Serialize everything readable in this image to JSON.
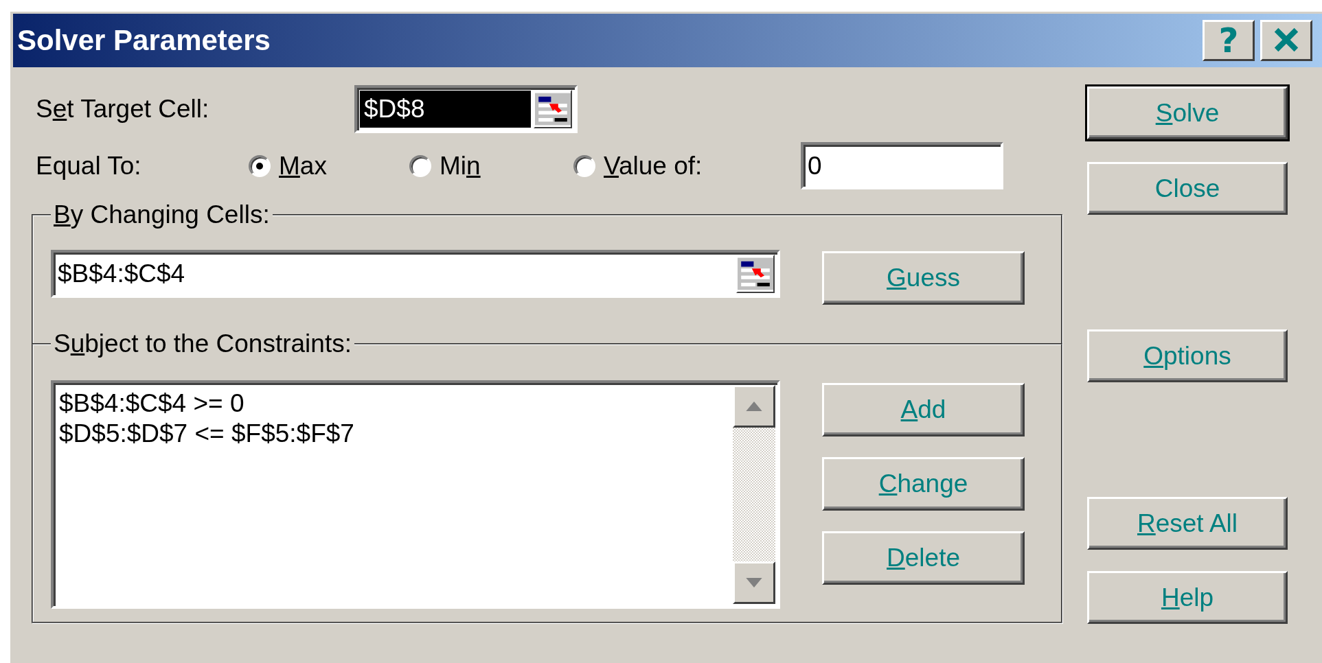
{
  "window": {
    "title": "Solver Parameters",
    "controls": [
      {
        "kind": "help",
        "glyph": "?"
      },
      {
        "kind": "close"
      }
    ]
  },
  "target_cell": {
    "label": {
      "pre": "S",
      "key": "e",
      "post": "t Target Cell:"
    },
    "value": "$D$8",
    "highlighted": true
  },
  "equal_to": {
    "label": "Equal To:",
    "options": [
      {
        "label": {
          "key": "M",
          "post": "ax"
        },
        "selected": true
      },
      {
        "label": {
          "pre": "Mi",
          "key": "n"
        },
        "selected": false
      },
      {
        "label": {
          "key": "V",
          "post": "alue of:"
        },
        "selected": false
      }
    ],
    "value_field": "0"
  },
  "changing_cells": {
    "title": {
      "key": "B",
      "post": "y Changing Cells:"
    },
    "value": "$B$4:$C$4",
    "button": {
      "key": "G",
      "post": "uess"
    }
  },
  "constraints": {
    "title": {
      "pre": "S",
      "key": "u",
      "post": "bject to the Constraints:"
    },
    "items": [
      "$B$4:$C$4 >= 0",
      "$D$5:$D$7 <= $F$5:$F$7"
    ],
    "buttons": [
      {
        "key": "A",
        "post": "dd"
      },
      {
        "key": "C",
        "post": "hange"
      },
      {
        "key": "D",
        "post": "elete"
      }
    ]
  },
  "side_buttons": [
    {
      "label": {
        "key": "S",
        "post": "olve"
      },
      "default": true
    },
    {
      "label": {
        "pre": "Close"
      },
      "default": false
    },
    {
      "label": {
        "key": "O",
        "post": "ptions"
      },
      "default": false
    },
    {
      "label": {
        "key": "R",
        "post": "eset All"
      },
      "default": false
    },
    {
      "label": {
        "key": "H",
        "post": "elp"
      },
      "default": false
    }
  ]
}
